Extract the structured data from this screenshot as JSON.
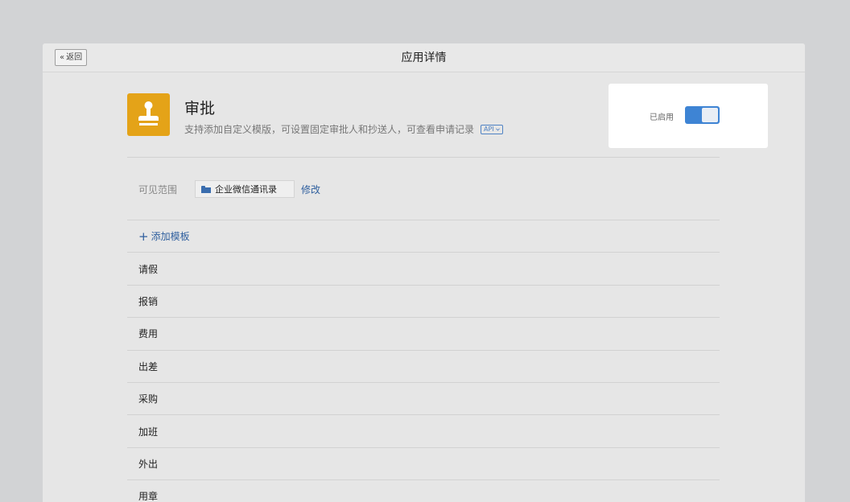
{
  "header": {
    "back_label": "返回",
    "back_icon": "double-chevron-left-icon",
    "title": "应用详情"
  },
  "app": {
    "name": "审批",
    "description": "支持添加自定义模版，可设置固定审批人和抄送人，可查看申请记录",
    "api_badge": "API",
    "icon": "stamp-icon",
    "icon_color": "#e4a318"
  },
  "status": {
    "label": "已启用",
    "enabled": true,
    "toggle_color": "#3e84d4"
  },
  "scope": {
    "label": "可见范围",
    "value": "企业微信通讯录",
    "modify_label": "修改"
  },
  "templates": {
    "add_label": "添加模板",
    "items": [
      "请假",
      "报销",
      "费用",
      "出差",
      "采购",
      "加班",
      "外出",
      "用章"
    ]
  }
}
